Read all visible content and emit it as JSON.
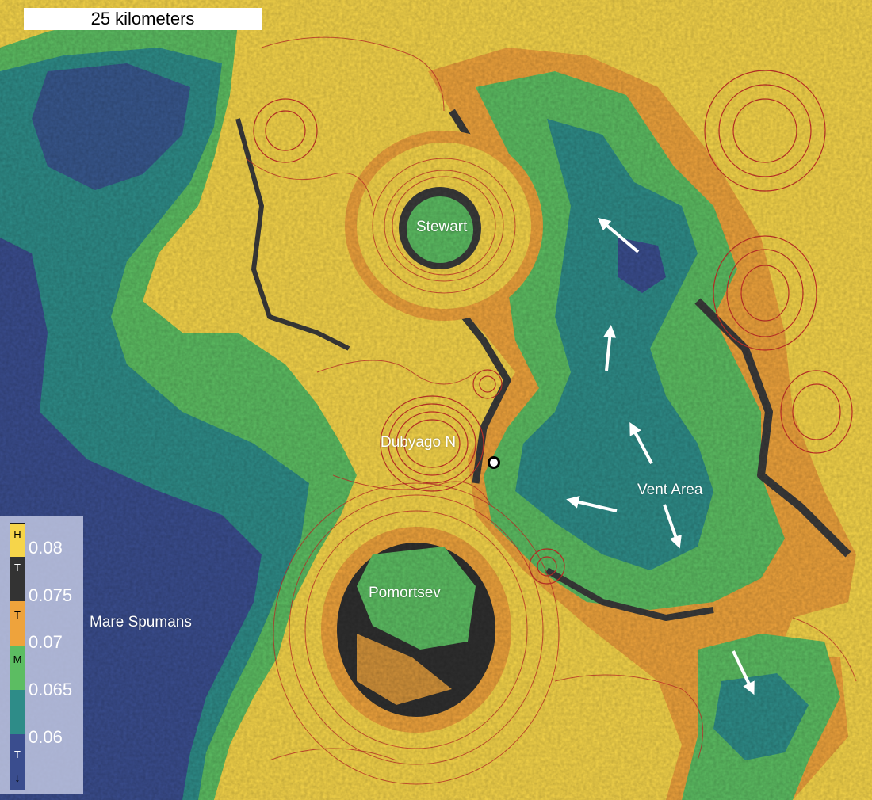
{
  "scale_bar": {
    "label": "25 kilometers"
  },
  "places": {
    "stewart": "Stewart",
    "dubyago_n": "Dubyago N",
    "vent_area": "Vent Area",
    "pomortsev": "Pomortsev",
    "mare_spumans": "Mare Spumans"
  },
  "legend": {
    "class_letters": {
      "high_ti_h": "H",
      "t_dark": "T",
      "t_orange": "T",
      "m": "M",
      "low_t": "T"
    },
    "ticks": [
      "0.08",
      "0.075",
      "0.07",
      "0.065",
      "0.06"
    ]
  },
  "colors": {
    "highlands_yellow": "#f6d54a",
    "transitional_orange": "#eea33c",
    "dark_gray": "#3a3a3a",
    "mare_green": "#5cbd62",
    "mare_teal": "#2e8c88",
    "mare_navy": "#3a4d8e",
    "contour_red": "#c8342a",
    "arrow_white": "#ffffff"
  },
  "icons": {
    "vent_marker": "white-circle-marker",
    "flow_arrows": "white-arrow-icon"
  }
}
